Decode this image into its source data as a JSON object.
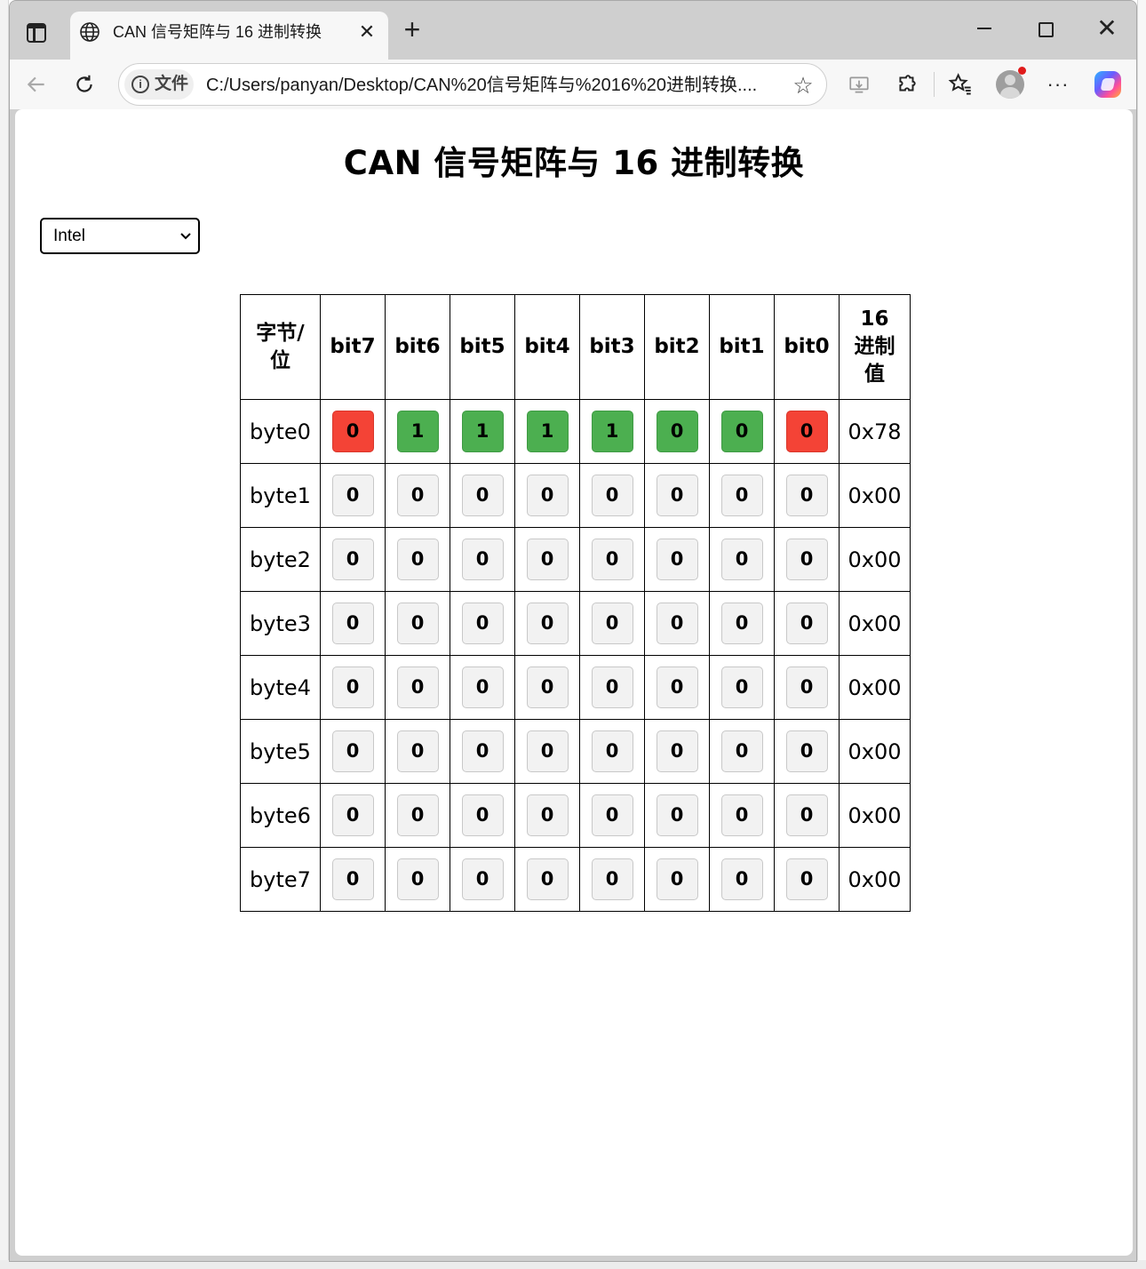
{
  "browser": {
    "tab": {
      "title": "CAN 信号矩阵与 16 进制转换"
    },
    "address": {
      "info_label": "文件",
      "url": "C:/Users/panyan/Desktop/CAN%20信号矩阵与%2016%20进制转换...."
    }
  },
  "page": {
    "title": "CAN 信号矩阵与 16 进制转换",
    "mode": {
      "selected": "Intel"
    },
    "table": {
      "header": {
        "label": "字节/位",
        "bits": [
          "bit7",
          "bit6",
          "bit5",
          "bit4",
          "bit3",
          "bit2",
          "bit1",
          "bit0"
        ],
        "hex": "16进制值"
      },
      "rows": [
        {
          "label": "byte0",
          "bits": [
            "0",
            "1",
            "1",
            "1",
            "1",
            "0",
            "0",
            "0"
          ],
          "hex": "0x78"
        },
        {
          "label": "byte1",
          "bits": [
            "0",
            "0",
            "0",
            "0",
            "0",
            "0",
            "0",
            "0"
          ],
          "hex": "0x00"
        },
        {
          "label": "byte2",
          "bits": [
            "0",
            "0",
            "0",
            "0",
            "0",
            "0",
            "0",
            "0"
          ],
          "hex": "0x00"
        },
        {
          "label": "byte3",
          "bits": [
            "0",
            "0",
            "0",
            "0",
            "0",
            "0",
            "0",
            "0"
          ],
          "hex": "0x00"
        },
        {
          "label": "byte4",
          "bits": [
            "0",
            "0",
            "0",
            "0",
            "0",
            "0",
            "0",
            "0"
          ],
          "hex": "0x00"
        },
        {
          "label": "byte5",
          "bits": [
            "0",
            "0",
            "0",
            "0",
            "0",
            "0",
            "0",
            "0"
          ],
          "hex": "0x00"
        },
        {
          "label": "byte6",
          "bits": [
            "0",
            "0",
            "0",
            "0",
            "0",
            "0",
            "0",
            "0"
          ],
          "hex": "0x00"
        },
        {
          "label": "byte7",
          "bits": [
            "0",
            "0",
            "0",
            "0",
            "0",
            "0",
            "0",
            "0"
          ],
          "hex": "0x00"
        }
      ]
    }
  },
  "colors": {
    "bit_green": "#4caf50",
    "bit_red": "#f44336",
    "bit_default": "#f2f2f2"
  },
  "icons": [
    "tab-actions-icon",
    "globe-icon",
    "close-icon",
    "plus-icon",
    "minimize-icon",
    "maximize-icon",
    "back-arrow-icon",
    "reload-icon",
    "info-icon",
    "star-icon",
    "app-install-icon",
    "extensions-icon",
    "favorites-icon",
    "profile-icon",
    "more-icon",
    "copilot-icon",
    "chevron-down-icon"
  ]
}
